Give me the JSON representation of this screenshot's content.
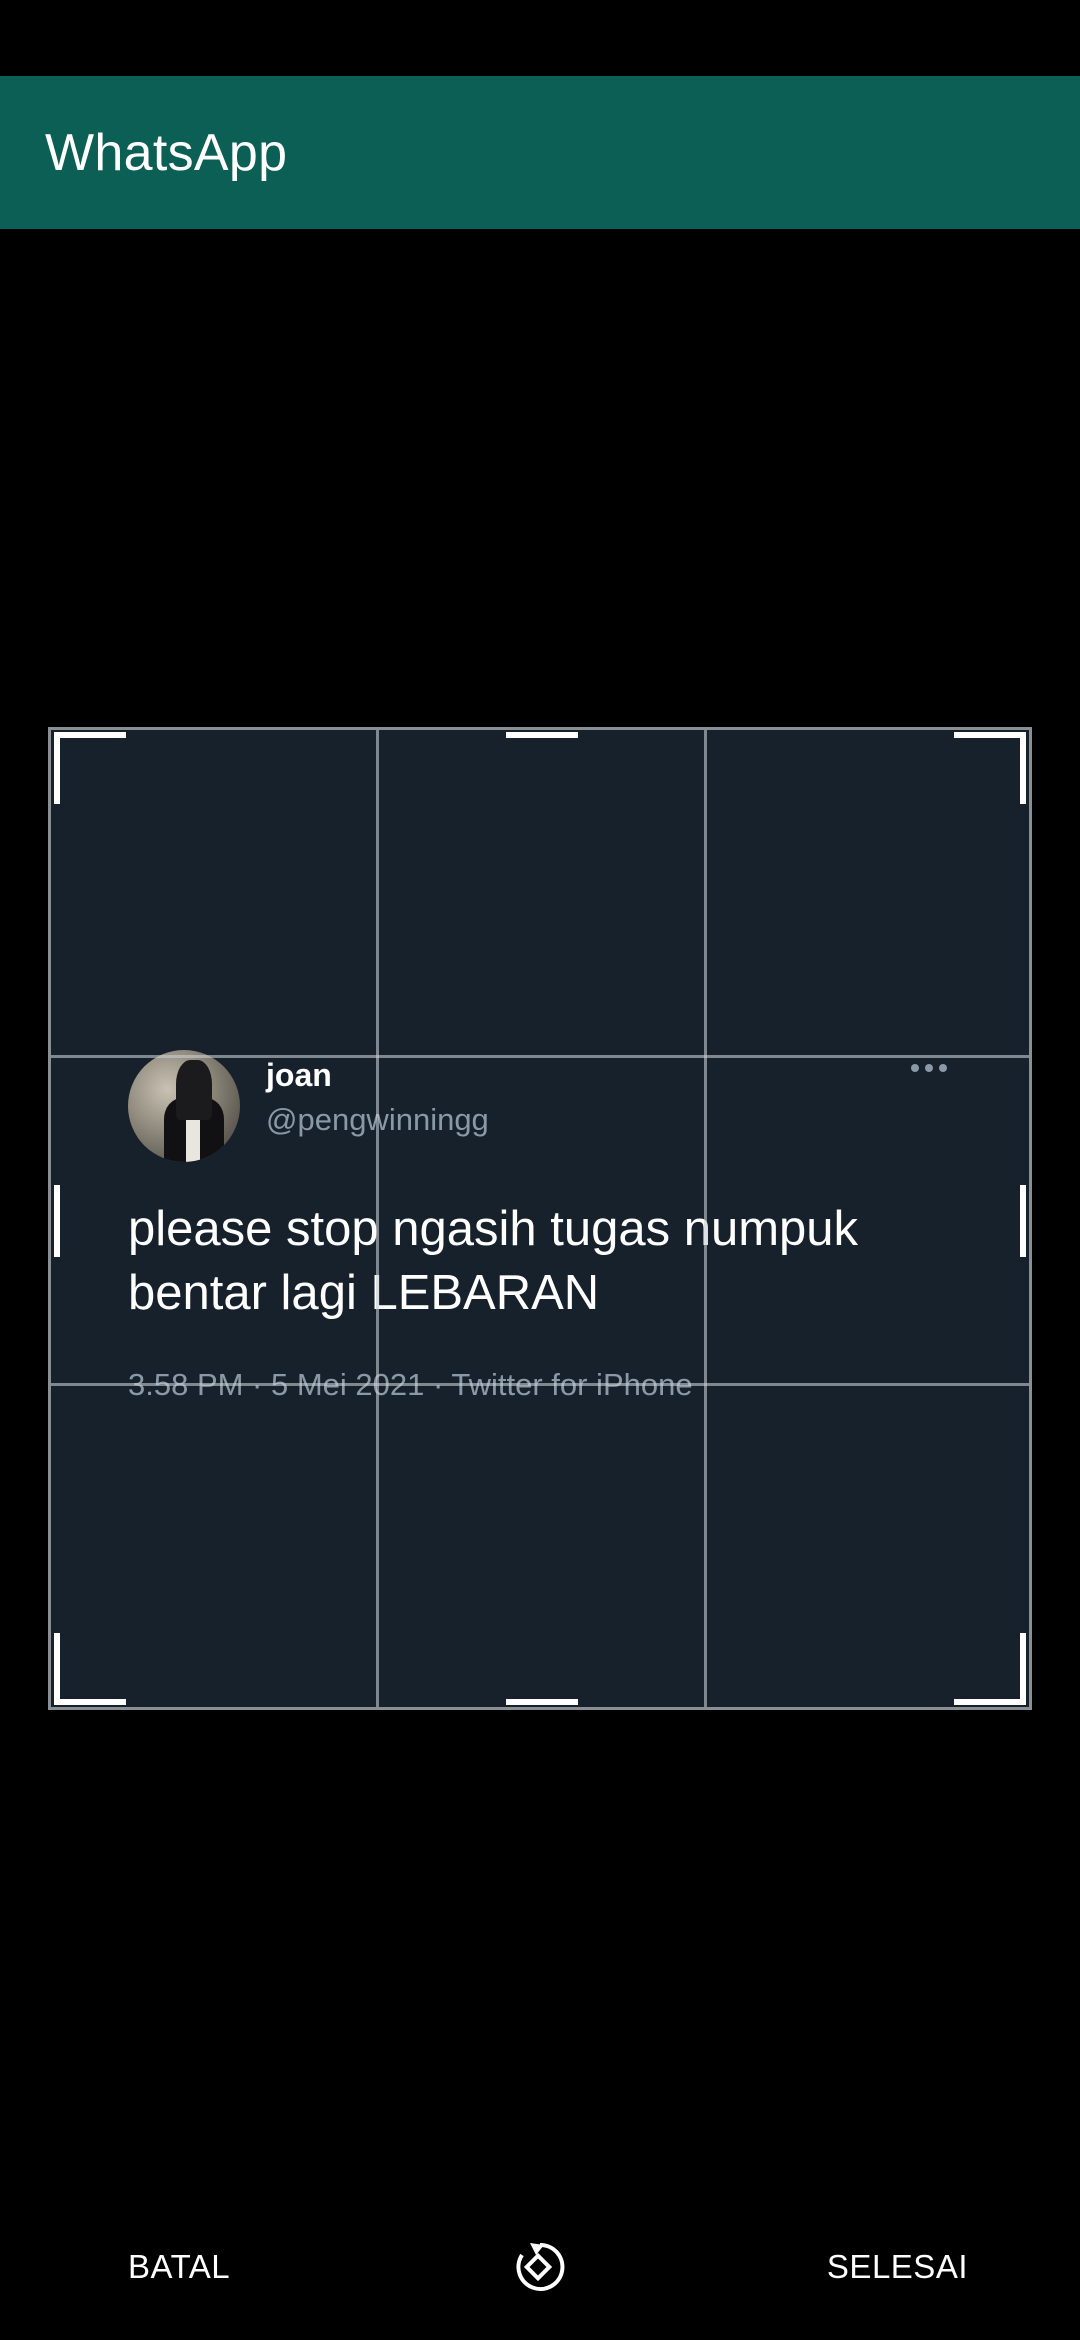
{
  "app": {
    "title": "WhatsApp"
  },
  "tweet": {
    "name": "joan",
    "handle": "@pengwinningg",
    "text": "please stop ngasih tugas numpuk bentar lagi LEBARAN",
    "meta": "3.58 PM · 5 Mei 2021 · Twitter for iPhone"
  },
  "toolbar": {
    "cancel_label": "BATAL",
    "done_label": "SELESAI",
    "rotate_icon": "rotate-icon"
  },
  "colors": {
    "app_bar": "#0b5f54",
    "tweet_bg": "#16212c",
    "secondary_text": "#8b98a5"
  }
}
